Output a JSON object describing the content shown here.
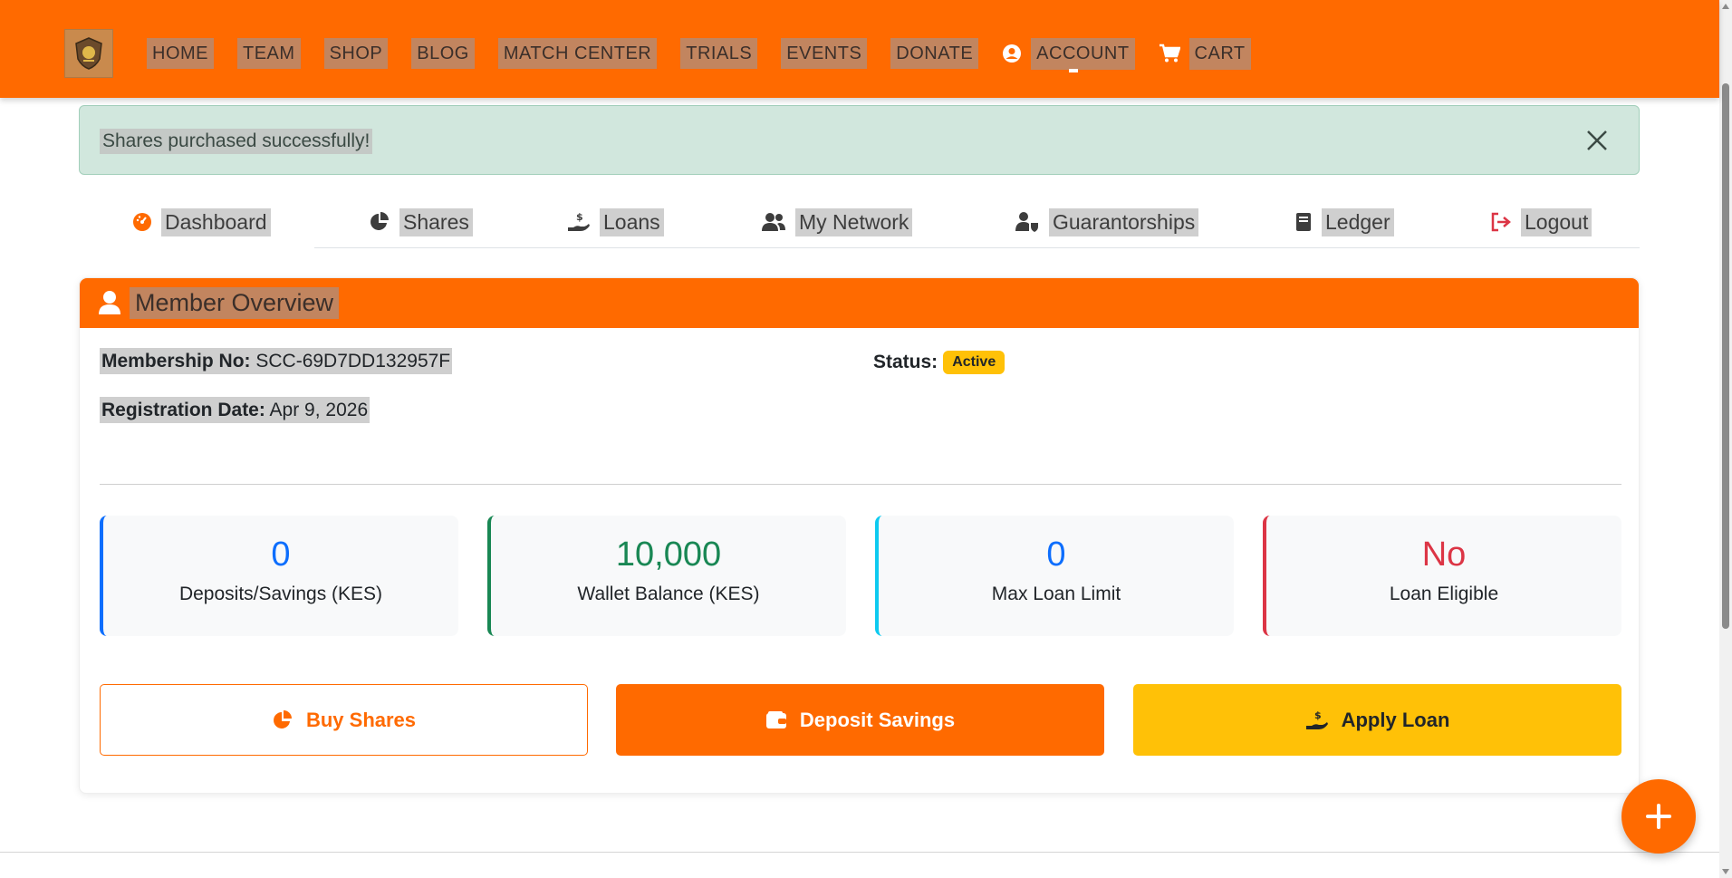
{
  "nav": {
    "items": [
      {
        "label": "HOME"
      },
      {
        "label": "TEAM"
      },
      {
        "label": "SHOP"
      },
      {
        "label": "BLOG"
      },
      {
        "label": "MATCH CENTER"
      },
      {
        "label": "TRIALS"
      },
      {
        "label": "EVENTS"
      },
      {
        "label": "DONATE"
      },
      {
        "label": "ACCOUNT"
      },
      {
        "label": "CART"
      }
    ]
  },
  "alert": {
    "message": "Shares purchased successfully!"
  },
  "tabs": [
    {
      "label": "Dashboard",
      "icon": "gauge-icon"
    },
    {
      "label": "Shares",
      "icon": "pie-chart-icon"
    },
    {
      "label": "Loans",
      "icon": "hand-dollar-icon"
    },
    {
      "label": "My Network",
      "icon": "users-icon"
    },
    {
      "label": "Guarantorships",
      "icon": "user-shield-icon"
    },
    {
      "label": "Ledger",
      "icon": "book-icon"
    },
    {
      "label": "Logout",
      "icon": "sign-out-icon"
    }
  ],
  "overview": {
    "title": "Member Overview",
    "membership_label": "Membership No:",
    "membership_value": "SCC-69D7DD132957F",
    "registration_label": "Registration Date:",
    "registration_value": "Apr 9, 2026",
    "status_label": "Status:",
    "status_value": "Active"
  },
  "stats": [
    {
      "value": "0",
      "caption": "Deposits/Savings (KES)",
      "color": "#0d6efd"
    },
    {
      "value": "10,000",
      "caption": "Wallet Balance (KES)",
      "color": "#198754"
    },
    {
      "value": "0",
      "caption": "Max Loan Limit",
      "color": "#0d6efd"
    },
    {
      "value": "No",
      "caption": "Loan Eligible",
      "color": "#dc3545"
    }
  ],
  "actions": {
    "buy_shares": "Buy Shares",
    "deposit_savings": "Deposit Savings",
    "apply_loan": "Apply Loan"
  },
  "colors": {
    "brand": "#ff6a00",
    "warning": "#ffc107",
    "success_bg": "#d1e7dd"
  }
}
